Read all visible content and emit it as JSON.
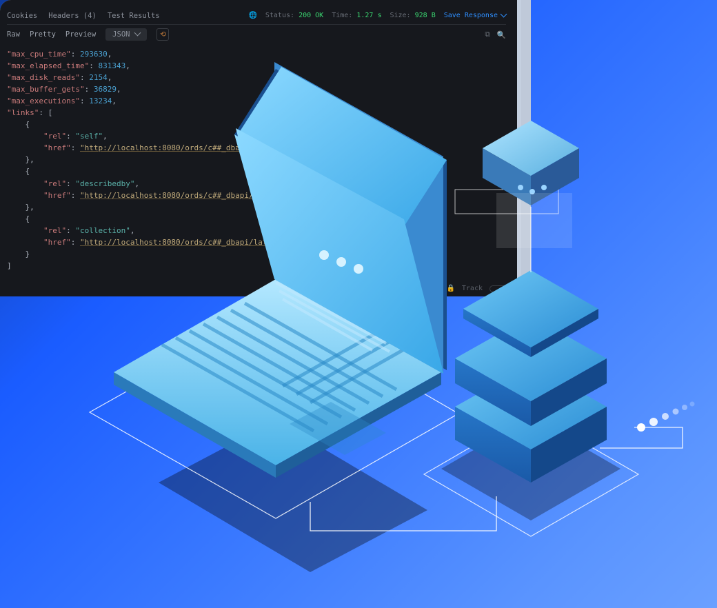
{
  "api_panel": {
    "tabs": {
      "cookies": "Cookies",
      "headers": "Headers (4)",
      "test_results": "Test Results"
    },
    "stats": {
      "status_label": "Status:",
      "status_value": "200 OK",
      "time_label": "Time:",
      "time_value": "1.27 s",
      "size_label": "Size:",
      "size_value": "928 B"
    },
    "save_response": "Save Response",
    "subtabs": {
      "raw": "Raw",
      "pretty": "Pretty",
      "preview": "Preview",
      "json_label": "JSON"
    },
    "footer_label": "Track"
  },
  "code_fields": {
    "max_cpu_time": {
      "key": "\"max_cpu_time\"",
      "value": "293630"
    },
    "max_elapsed_time": {
      "key": "\"max_elapsed_time\"",
      "value": "831343"
    },
    "max_disk_reads": {
      "key": "\"max_disk_reads\"",
      "value": "2154"
    },
    "max_buffer_gets": {
      "key": "\"max_buffer_gets\"",
      "value": "36829"
    },
    "max_executions": {
      "key": "\"max_executions\"",
      "value": "13234"
    },
    "links_key": "\"links\"",
    "links": [
      {
        "rel_key": "\"rel\"",
        "rel_val": "\"self\"",
        "href_key": "\"href\"",
        "href_val": "\"http://localhost:8080/ords/c##_dbapi/latest/database/monitoring/sessions\""
      },
      {
        "rel_key": "\"rel\"",
        "rel_val": "\"describedby\"",
        "href_key": "\"href\"",
        "href_val": "\"http://localhost:8080/ords/c##_dbapi/latest/me\""
      },
      {
        "rel_key": "\"rel\"",
        "rel_val": "\"collection\"",
        "href_key": "\"href\"",
        "href_val": "\"http://localhost:8080/ords/c##_dbapi/latest\""
      }
    ]
  }
}
